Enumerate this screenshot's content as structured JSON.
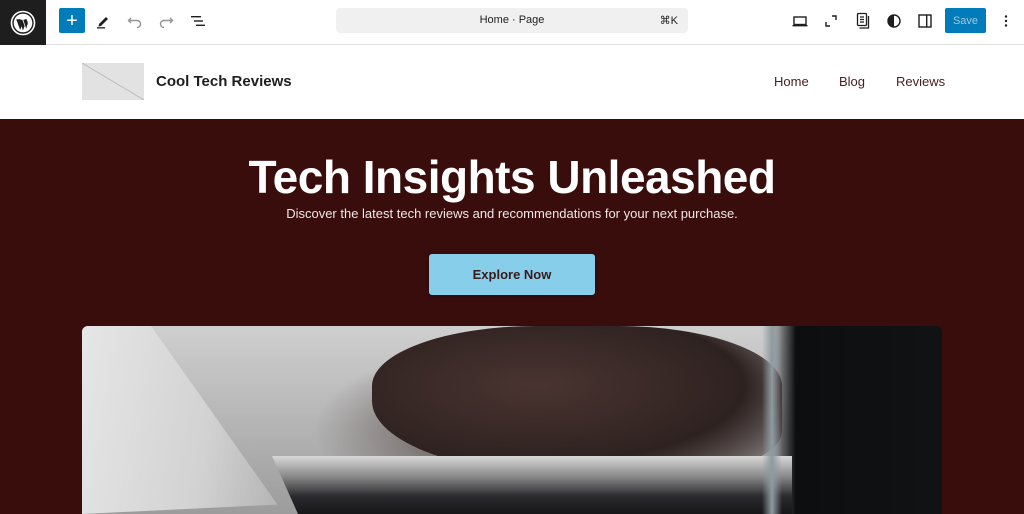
{
  "toolbar": {
    "logo_icon": "wordpress-logo",
    "add_icon": "+",
    "tools": [
      "pencil-icon",
      "undo-icon",
      "redo-icon",
      "document-overview-icon"
    ],
    "command_bar": {
      "title": "Home · Page",
      "shortcut": "⌘K"
    },
    "right_tools": [
      "view-desktop-icon",
      "fullscreen-icon",
      "revisions-icon",
      "styles-icon",
      "settings-panel-icon"
    ],
    "save_label": "Save",
    "more_icon": "⋮"
  },
  "site_header": {
    "title": "Cool Tech Reviews",
    "nav": [
      {
        "label": "Home"
      },
      {
        "label": "Blog"
      },
      {
        "label": "Reviews"
      }
    ],
    "nav_color": "#4a1d1d"
  },
  "hero": {
    "title": "Tech Insights Unleashed",
    "subtitle": "Discover the latest tech reviews and recommendations for your next purchase.",
    "cta_label": "Explore Now",
    "background_color": "#3a0d0d",
    "cta_color": "#87ceeb",
    "image_alt": "hands typing on laptop"
  },
  "colors": {
    "accent": "#007cba",
    "toolbar_dark": "#1e1e1e"
  }
}
